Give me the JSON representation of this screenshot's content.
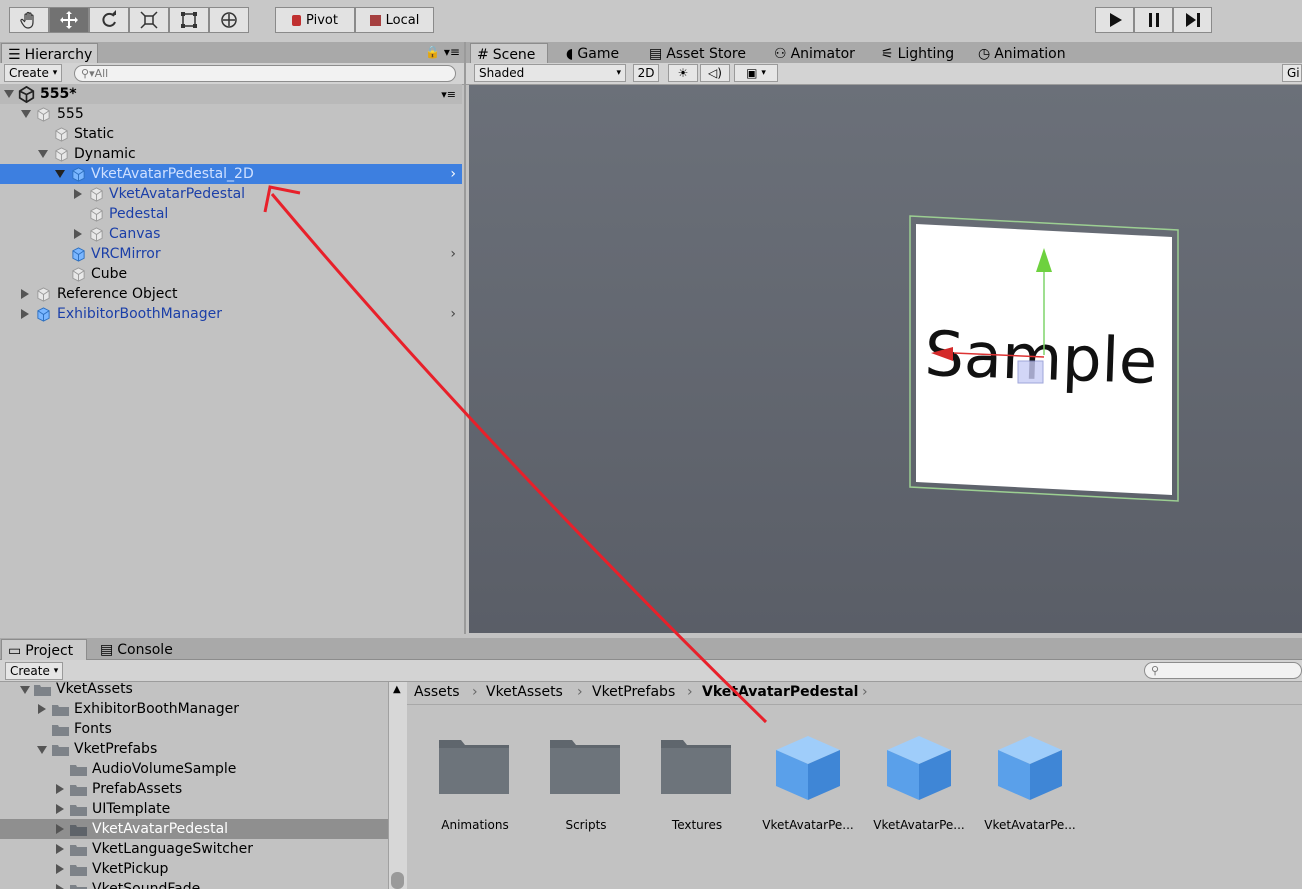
{
  "toolbar": {
    "tools": [
      "hand-tool-icon",
      "move-tool-icon",
      "rotate-tool-icon",
      "scale-tool-icon",
      "rect-tool-icon",
      "transform-tool-icon"
    ],
    "pivot_label": "Pivot",
    "local_label": "Local"
  },
  "hierarchy": {
    "tab_label": "Hierarchy",
    "create_label": "Create",
    "search_placeholder": "All",
    "scene_name": "555*",
    "rows": [
      {
        "label": "555"
      },
      {
        "label": "Static"
      },
      {
        "label": "Dynamic"
      },
      {
        "label": "VketAvatarPedestal_2D"
      },
      {
        "label": "VketAvatarPedestal"
      },
      {
        "label": "Pedestal"
      },
      {
        "label": "Canvas"
      },
      {
        "label": "VRCMirror"
      },
      {
        "label": "Cube"
      },
      {
        "label": "Reference Object"
      },
      {
        "label": "ExhibitorBoothManager"
      }
    ]
  },
  "scene": {
    "tabs": [
      "Scene",
      "Game",
      "Asset Store",
      "Animator",
      "Lighting",
      "Animation"
    ],
    "shading_mode": "Shaded",
    "mode_2d": "2D",
    "gizmos_label": "Gi",
    "sample_text": "Sample"
  },
  "project": {
    "tabs": [
      "Project",
      "Console"
    ],
    "create_label": "Create",
    "tree": [
      {
        "label": "VketAssets"
      },
      {
        "label": "ExhibitorBoothManager"
      },
      {
        "label": "Fonts"
      },
      {
        "label": "VketPrefabs"
      },
      {
        "label": "AudioVolumeSample"
      },
      {
        "label": "PrefabAssets"
      },
      {
        "label": "UITemplate"
      },
      {
        "label": "VketAvatarPedestal"
      },
      {
        "label": "VketLanguageSwitcher"
      },
      {
        "label": "VketPickup"
      },
      {
        "label": "VketSoundFade"
      }
    ],
    "breadcrumb": [
      "Assets",
      "VketAssets",
      "VketPrefabs",
      "VketAvatarPedestal"
    ],
    "assets": [
      {
        "label": "Animations",
        "kind": "folder"
      },
      {
        "label": "Scripts",
        "kind": "folder"
      },
      {
        "label": "Textures",
        "kind": "folder"
      },
      {
        "label": "VketAvatarPe...",
        "kind": "prefab"
      },
      {
        "label": "VketAvatarPe...",
        "kind": "prefab"
      },
      {
        "label": "VketAvatarPe...",
        "kind": "prefab"
      }
    ]
  },
  "colors": {
    "selection": "#3d7fe0",
    "prefab_text": "#1b3fa8",
    "annotation_arrow": "#e8202a"
  }
}
